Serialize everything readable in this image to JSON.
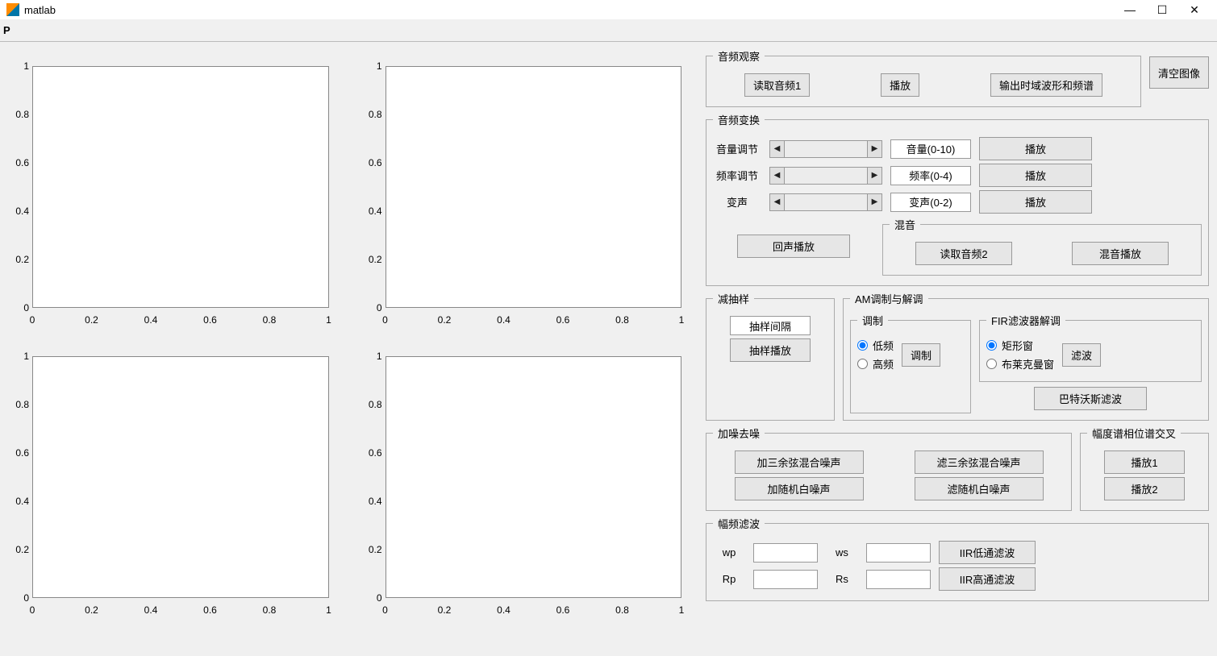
{
  "window": {
    "title": "matlab"
  },
  "toolbar": {
    "label": "P"
  },
  "ticks": {
    "y": [
      "0",
      "0.2",
      "0.4",
      "0.6",
      "0.8",
      "1"
    ],
    "x": [
      "0",
      "0.2",
      "0.4",
      "0.6",
      "0.8",
      "1"
    ]
  },
  "audio_observe": {
    "legend": "音频观察",
    "read1": "读取音频1",
    "play": "播放",
    "output": "输出时域波形和频谱",
    "clear": "清空图像"
  },
  "audio_transform": {
    "legend": "音频变换",
    "vol_label": "音量调节",
    "vol_box": "音量(0-10)",
    "vol_play": "播放",
    "freq_label": "频率调节",
    "freq_box": "频率(0-4)",
    "freq_play": "播放",
    "voice_label": "变声",
    "voice_box": "变声(0-2)",
    "voice_play": "播放",
    "echo_play": "回声播放",
    "mix_legend": "混音",
    "read2": "读取音频2",
    "mix_play": "混音播放"
  },
  "downsample": {
    "legend": "减抽样",
    "interval": "抽样间隔",
    "play": "抽样播放"
  },
  "am": {
    "legend": "AM调制与解调",
    "mod_legend": "调制",
    "low": "低频",
    "high": "高频",
    "mod_btn": "调制",
    "fir_legend": "FIR滤波器解调",
    "rect": "矩形窗",
    "blackman": "布莱克曼窗",
    "filter_btn": "滤波",
    "butter": "巴特沃斯滤波"
  },
  "noise": {
    "legend": "加噪去噪",
    "add_cos": "加三余弦混合噪声",
    "filt_cos": "滤三余弦混合噪声",
    "add_white": "加随机白噪声",
    "filt_white": "滤随机白噪声"
  },
  "cross": {
    "legend": "幅度谱相位谱交叉",
    "play1": "播放1",
    "play2": "播放2"
  },
  "ampfilt": {
    "legend": "幅频滤波",
    "wp": "wp",
    "ws": "ws",
    "rp": "Rp",
    "rs": "Rs",
    "iir_low": "IIR低通滤波",
    "iir_high": "IIR高通滤波"
  }
}
